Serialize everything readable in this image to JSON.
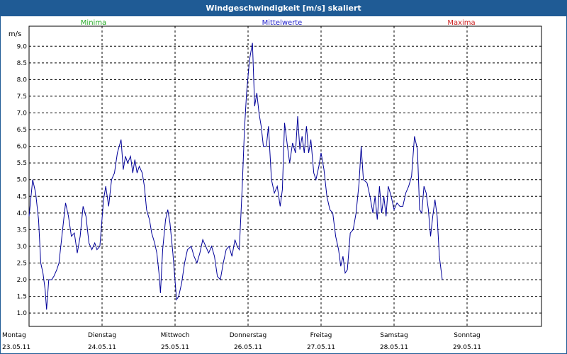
{
  "window": {
    "title": "Windgeschwindigkeit [m/s] skaliert"
  },
  "legend": {
    "minima": "Minima",
    "mittelwerte": "Mittelwerte",
    "maxima": "Maxima"
  },
  "colors": {
    "titlebar": "#1f5b95",
    "minima": "#22aa22",
    "mittelwerte": "#2222cc",
    "maxima": "#cc2222",
    "line": "#000099"
  },
  "chart_data": {
    "type": "line",
    "ylabel": "m/s",
    "ylim": [
      0.6,
      9.6
    ],
    "yticks": [
      "1.0",
      "1.5",
      "2.0",
      "2.5",
      "3.0",
      "3.5",
      "4.0",
      "4.5",
      "5.0",
      "5.5",
      "6.0",
      "6.5",
      "7.0",
      "7.5",
      "8.0",
      "8.5",
      "9.0"
    ],
    "xlim": [
      0,
      7
    ],
    "days": [
      {
        "name": "Montag",
        "date": "23.05.11"
      },
      {
        "name": "Dienstag",
        "date": "24.05.11"
      },
      {
        "name": "Mittwoch",
        "date": "25.05.11"
      },
      {
        "name": "Donnerstag",
        "date": "26.05.11"
      },
      {
        "name": "Freitag",
        "date": "27.05.11"
      },
      {
        "name": "Samstag",
        "date": "28.05.11"
      },
      {
        "name": "Sonntag",
        "date": "29.05.11"
      }
    ],
    "grid": true,
    "series": [
      {
        "values": [
          [
            0.0,
            3.9
          ],
          [
            0.05,
            5.0
          ],
          [
            0.09,
            4.6
          ],
          [
            0.13,
            3.8
          ],
          [
            0.16,
            2.5
          ],
          [
            0.19,
            2.2
          ],
          [
            0.22,
            1.7
          ],
          [
            0.24,
            1.1
          ],
          [
            0.27,
            2.0
          ],
          [
            0.31,
            2.0
          ],
          [
            0.34,
            2.1
          ],
          [
            0.38,
            2.3
          ],
          [
            0.41,
            2.5
          ],
          [
            0.45,
            3.3
          ],
          [
            0.5,
            4.3
          ],
          [
            0.54,
            3.9
          ],
          [
            0.58,
            3.3
          ],
          [
            0.62,
            3.4
          ],
          [
            0.66,
            2.8
          ],
          [
            0.7,
            3.3
          ],
          [
            0.74,
            4.2
          ],
          [
            0.78,
            3.9
          ],
          [
            0.82,
            3.1
          ],
          [
            0.86,
            2.9
          ],
          [
            0.9,
            3.1
          ],
          [
            0.93,
            2.9
          ],
          [
            0.97,
            3.0
          ],
          [
            1.02,
            4.4
          ],
          [
            1.05,
            4.8
          ],
          [
            1.09,
            4.2
          ],
          [
            1.13,
            5.0
          ],
          [
            1.17,
            5.2
          ],
          [
            1.21,
            5.8
          ],
          [
            1.26,
            6.2
          ],
          [
            1.29,
            5.3
          ],
          [
            1.32,
            5.7
          ],
          [
            1.35,
            5.5
          ],
          [
            1.39,
            5.7
          ],
          [
            1.42,
            5.2
          ],
          [
            1.45,
            5.6
          ],
          [
            1.48,
            5.2
          ],
          [
            1.51,
            5.4
          ],
          [
            1.55,
            5.2
          ],
          [
            1.58,
            4.8
          ],
          [
            1.61,
            4.1
          ],
          [
            1.65,
            3.8
          ],
          [
            1.68,
            3.4
          ],
          [
            1.72,
            3.1
          ],
          [
            1.75,
            2.8
          ],
          [
            1.78,
            2.2
          ],
          [
            1.8,
            1.6
          ],
          [
            1.83,
            2.9
          ],
          [
            1.87,
            3.8
          ],
          [
            1.9,
            4.1
          ],
          [
            1.93,
            3.7
          ],
          [
            1.97,
            2.8
          ],
          [
            2.02,
            1.4
          ],
          [
            2.05,
            1.5
          ],
          [
            2.09,
            1.9
          ],
          [
            2.13,
            2.5
          ],
          [
            2.17,
            2.9
          ],
          [
            2.22,
            3.0
          ],
          [
            2.26,
            2.7
          ],
          [
            2.3,
            2.5
          ],
          [
            2.34,
            2.8
          ],
          [
            2.38,
            3.2
          ],
          [
            2.42,
            3.0
          ],
          [
            2.46,
            2.8
          ],
          [
            2.5,
            3.0
          ],
          [
            2.54,
            2.7
          ],
          [
            2.58,
            2.1
          ],
          [
            2.62,
            2.0
          ],
          [
            2.66,
            2.5
          ],
          [
            2.7,
            2.9
          ],
          [
            2.74,
            3.0
          ],
          [
            2.78,
            2.7
          ],
          [
            2.82,
            3.2
          ],
          [
            2.85,
            3.0
          ],
          [
            2.88,
            2.9
          ],
          [
            2.92,
            4.8
          ],
          [
            2.95,
            6.5
          ],
          [
            2.98,
            7.6
          ],
          [
            3.02,
            8.6
          ],
          [
            3.06,
            9.1
          ],
          [
            3.09,
            7.2
          ],
          [
            3.12,
            7.6
          ],
          [
            3.15,
            7.0
          ],
          [
            3.18,
            6.6
          ],
          [
            3.21,
            6.0
          ],
          [
            3.25,
            6.0
          ],
          [
            3.28,
            6.6
          ],
          [
            3.32,
            5.0
          ],
          [
            3.36,
            4.6
          ],
          [
            3.4,
            4.8
          ],
          [
            3.44,
            4.2
          ],
          [
            3.47,
            4.7
          ],
          [
            3.5,
            6.7
          ],
          [
            3.54,
            6.0
          ],
          [
            3.57,
            5.5
          ],
          [
            3.61,
            6.1
          ],
          [
            3.65,
            5.8
          ],
          [
            3.68,
            6.9
          ],
          [
            3.71,
            5.9
          ],
          [
            3.74,
            6.3
          ],
          [
            3.77,
            5.8
          ],
          [
            3.8,
            6.6
          ],
          [
            3.83,
            5.8
          ],
          [
            3.86,
            6.2
          ],
          [
            3.9,
            5.2
          ],
          [
            3.93,
            5.0
          ],
          [
            3.97,
            5.4
          ],
          [
            4.0,
            5.8
          ],
          [
            4.04,
            5.3
          ],
          [
            4.08,
            4.5
          ],
          [
            4.12,
            4.1
          ],
          [
            4.16,
            4.0
          ],
          [
            4.2,
            3.3
          ],
          [
            4.24,
            2.9
          ],
          [
            4.27,
            2.4
          ],
          [
            4.3,
            2.7
          ],
          [
            4.33,
            2.2
          ],
          [
            4.36,
            2.3
          ],
          [
            4.4,
            3.4
          ],
          [
            4.44,
            3.5
          ],
          [
            4.48,
            4.0
          ],
          [
            4.52,
            4.9
          ],
          [
            4.55,
            6.0
          ],
          [
            4.58,
            5.0
          ],
          [
            4.63,
            4.9
          ],
          [
            4.67,
            4.5
          ],
          [
            4.71,
            4.0
          ],
          [
            4.74,
            4.5
          ],
          [
            4.77,
            3.8
          ],
          [
            4.8,
            4.8
          ],
          [
            4.83,
            4.0
          ],
          [
            4.86,
            4.5
          ],
          [
            4.89,
            3.9
          ],
          [
            4.92,
            4.8
          ],
          [
            4.96,
            4.5
          ],
          [
            5.0,
            4.1
          ],
          [
            5.04,
            4.3
          ],
          [
            5.08,
            4.2
          ],
          [
            5.12,
            4.2
          ],
          [
            5.16,
            4.6
          ],
          [
            5.2,
            4.8
          ],
          [
            5.24,
            5.1
          ],
          [
            5.28,
            6.3
          ],
          [
            5.32,
            5.9
          ],
          [
            5.35,
            4.1
          ],
          [
            5.38,
            4.0
          ],
          [
            5.41,
            4.8
          ],
          [
            5.44,
            4.6
          ],
          [
            5.47,
            4.1
          ],
          [
            5.5,
            3.3
          ],
          [
            5.53,
            3.9
          ],
          [
            5.56,
            4.4
          ],
          [
            5.59,
            3.9
          ],
          [
            5.62,
            2.7
          ],
          [
            5.66,
            2.0
          ]
        ]
      }
    ]
  }
}
